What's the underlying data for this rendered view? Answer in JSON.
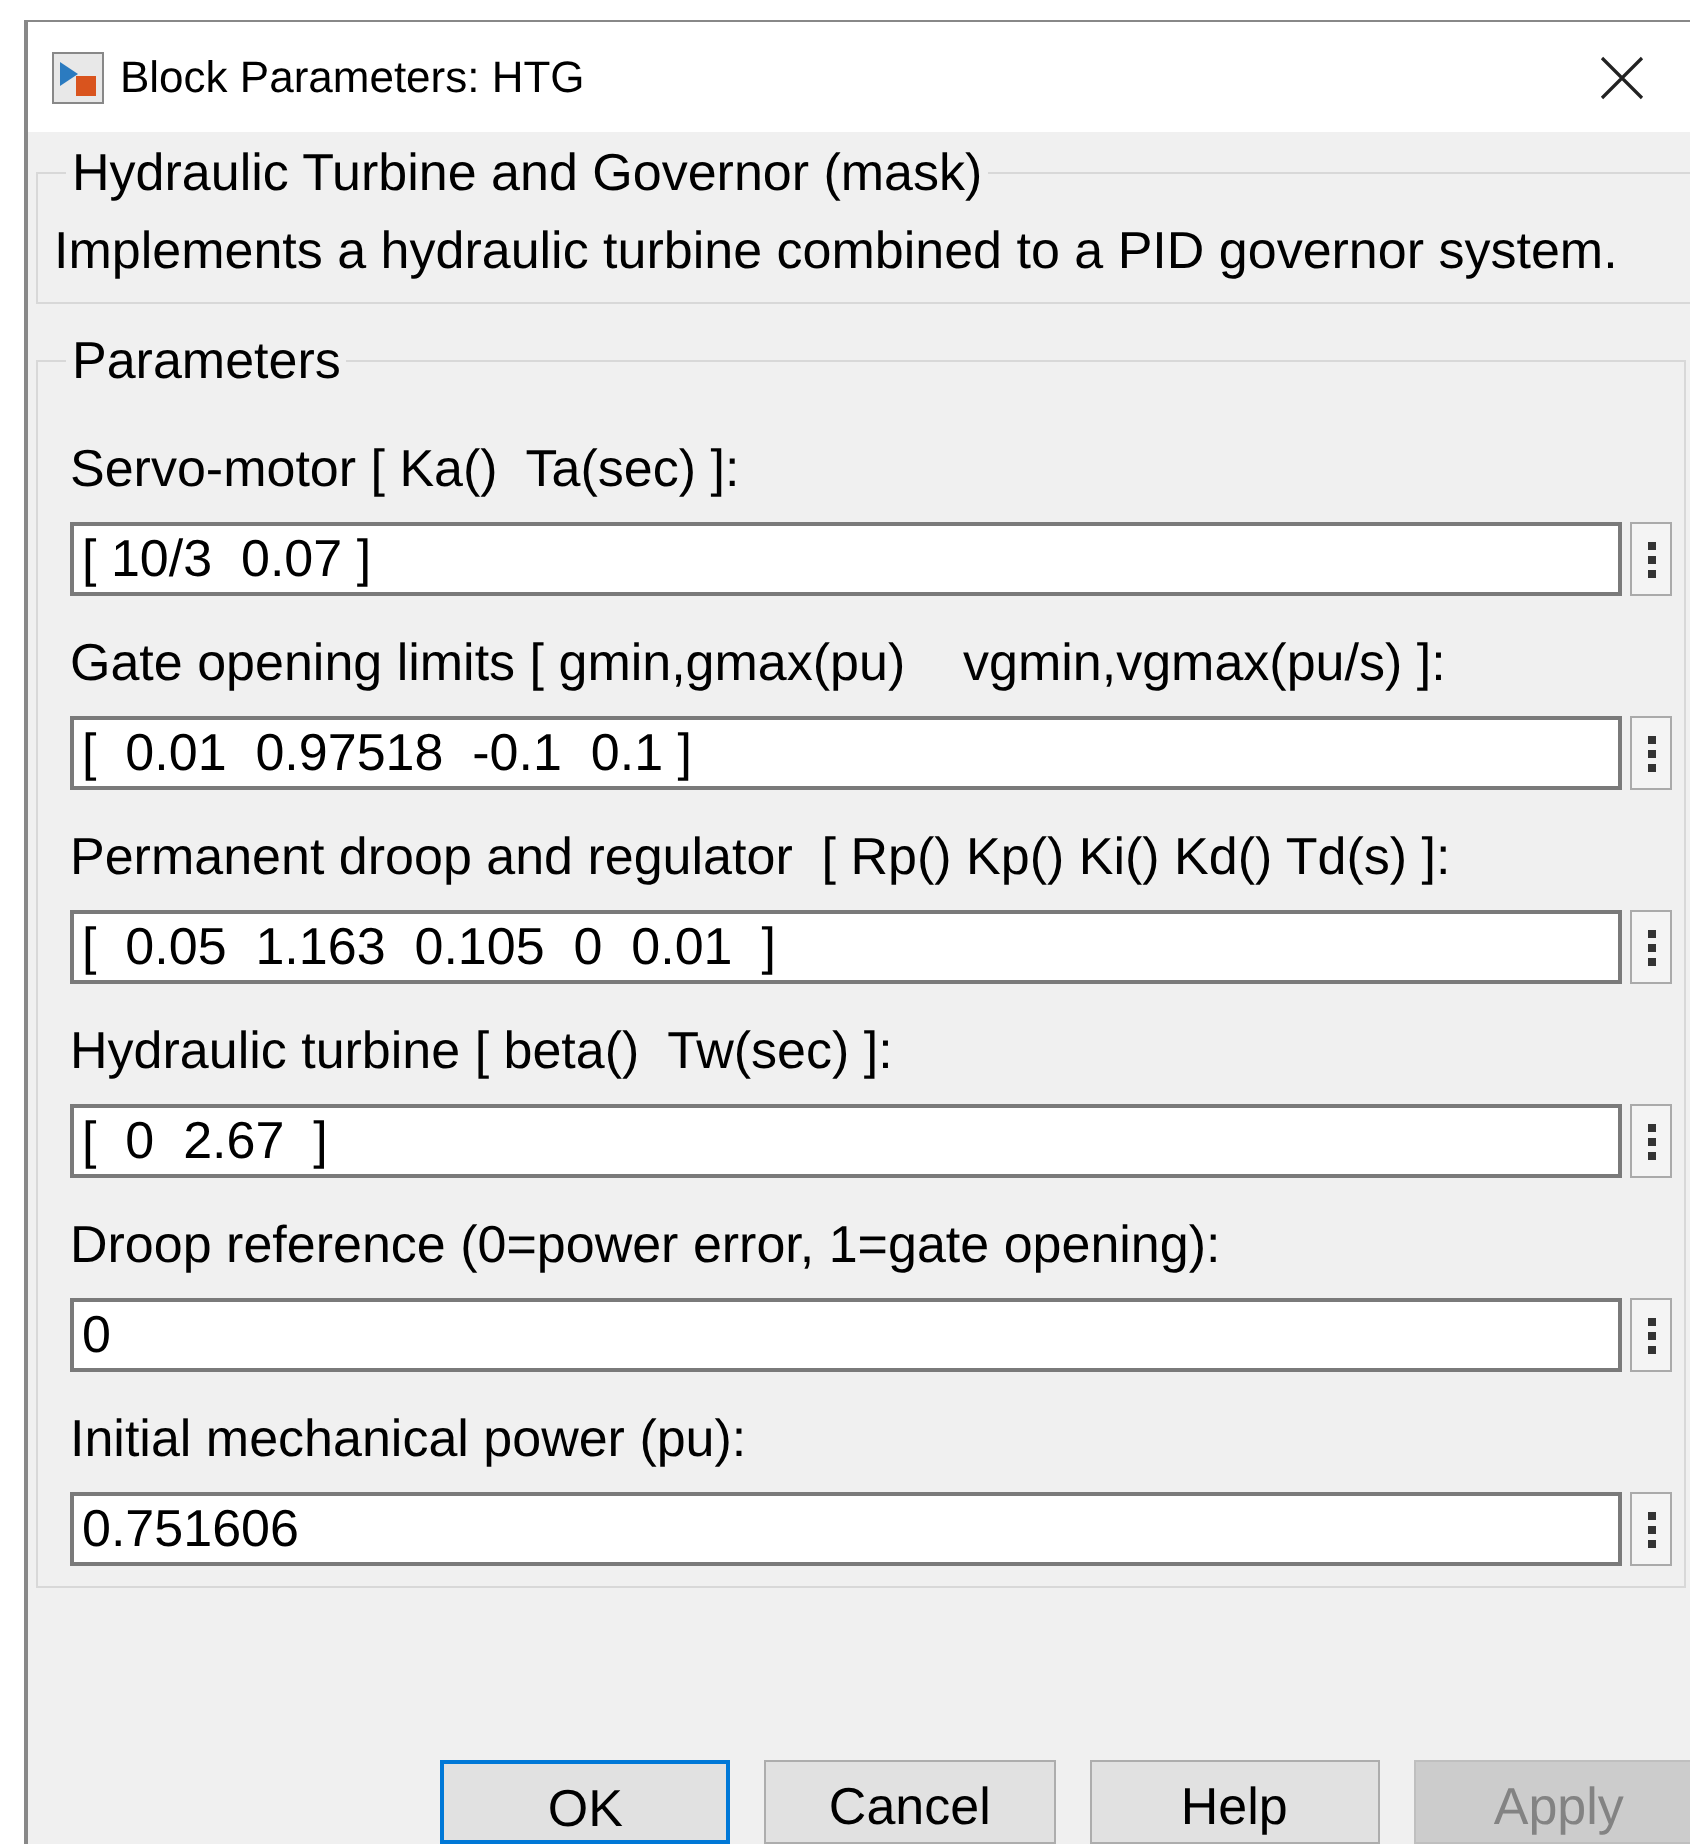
{
  "window": {
    "title": "Block Parameters: HTG"
  },
  "mask": {
    "title": "Hydraulic Turbine and Governor (mask)",
    "description": "Implements a hydraulic turbine combined to a PID governor system."
  },
  "parameters": {
    "title": "Parameters",
    "fields": [
      {
        "label": "Servo-motor [ Ka()  Ta(sec) ]:",
        "value": "[ 10/3  0.07 ]"
      },
      {
        "label": "Gate opening limits [ gmin,gmax(pu)    vgmin,vgmax(pu/s) ]:",
        "value": "[  0.01  0.97518  -0.1  0.1 ]"
      },
      {
        "label": "Permanent droop and regulator  [ Rp() Kp() Ki() Kd() Td(s) ]:",
        "value": "[  0.05  1.163  0.105  0  0.01  ]"
      },
      {
        "label": "Hydraulic turbine [ beta()  Tw(sec) ]:",
        "value": "[  0  2.67  ]"
      },
      {
        "label": "Droop reference (0=power error, 1=gate opening):",
        "value": "0"
      },
      {
        "label": "Initial mechanical power (pu):",
        "value": "0.751606"
      }
    ]
  },
  "buttons": [
    {
      "label": "OK",
      "default": true,
      "disabled": false
    },
    {
      "label": "Cancel",
      "default": false,
      "disabled": false
    },
    {
      "label": "Help",
      "default": false,
      "disabled": false
    },
    {
      "label": "Apply",
      "default": false,
      "disabled": true
    }
  ]
}
